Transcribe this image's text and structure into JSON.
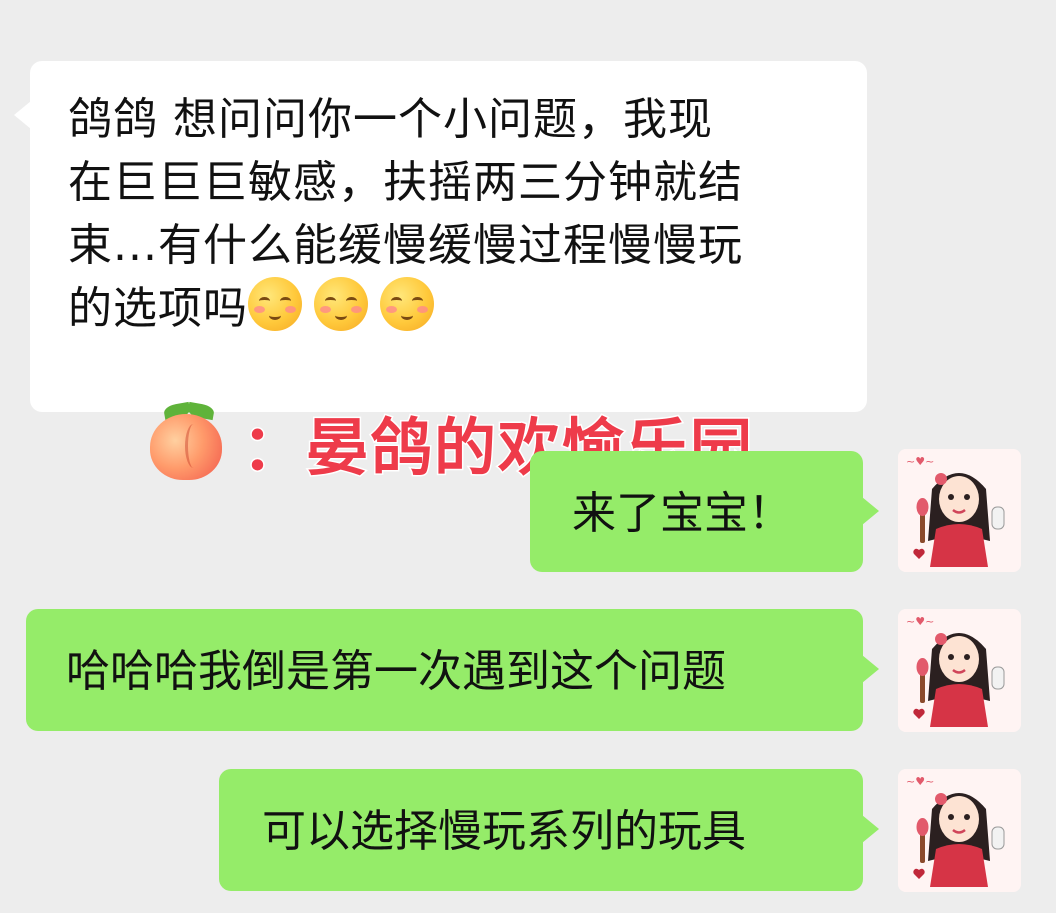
{
  "incoming_message": {
    "lines": [
      "鸽鸽 想问问你一个小问题，我现",
      "在巨巨巨敏感，扶摇两三分钟就结",
      "束...有什么能缓慢缓慢过程慢慢玩",
      "的选项吗"
    ],
    "trailing_emoji": [
      "blushing-face",
      "blushing-face",
      "blushing-face"
    ]
  },
  "watermark": {
    "icon": "peach-emoji",
    "text": "：晏鸽的欢愉乐园",
    "color": "#ee3b4a"
  },
  "outgoing_messages": [
    {
      "text": "来了宝宝！"
    },
    {
      "text": "哈哈哈我倒是第一次遇到这个问题"
    },
    {
      "text": "可以选择慢玩系列的玩具"
    }
  ],
  "colors": {
    "background": "#ededed",
    "incoming_bubble": "#ffffff",
    "outgoing_bubble": "#95ec69"
  }
}
